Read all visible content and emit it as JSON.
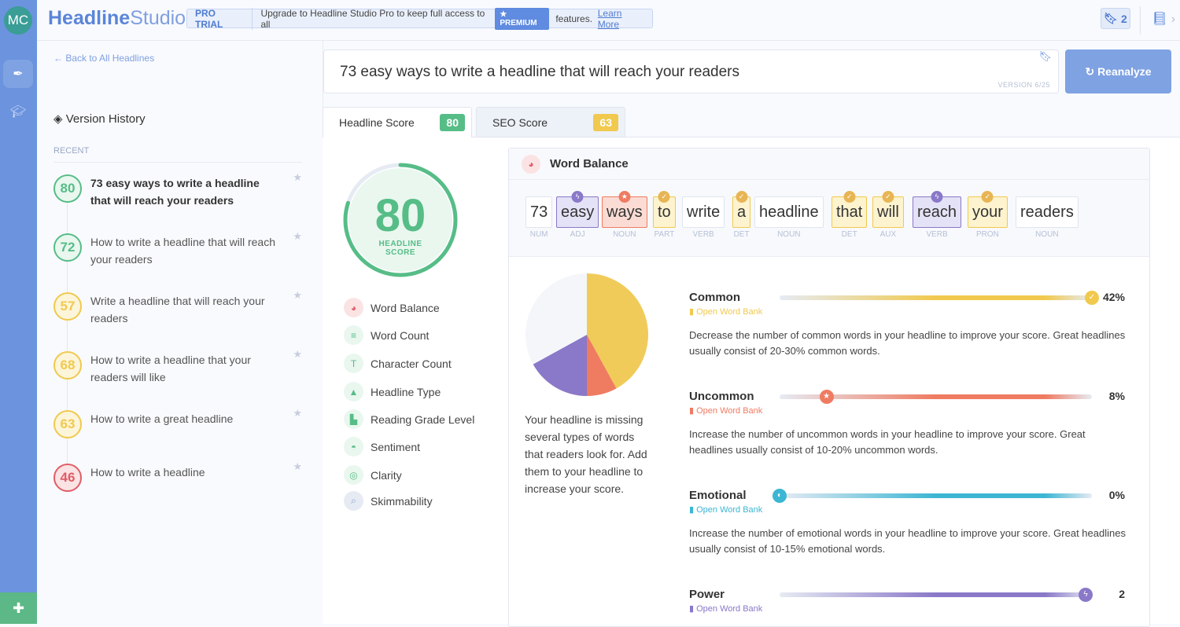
{
  "user": {
    "initials": "MC"
  },
  "app": {
    "name_bold": "Headline",
    "name_light": "Studio"
  },
  "promo": {
    "badge": "PRO TRIAL",
    "text": "Upgrade to Headline Studio Pro to keep full access to all",
    "premium": "PREMIUM",
    "after": "features.",
    "link": "Learn More"
  },
  "header": {
    "saved_count": "2"
  },
  "sidebar": {
    "back": "← Back to All Headlines",
    "version_history": "Version History",
    "recent": "RECENT",
    "items": [
      {
        "score": "80",
        "text": "73 easy ways to write a headline that will reach your readers",
        "color": "#56bd87",
        "bg": "#e9f7ef",
        "active": true
      },
      {
        "score": "72",
        "text": "How to write a headline that will reach your readers",
        "color": "#56bd87",
        "bg": "#e9f7ef"
      },
      {
        "score": "57",
        "text": "Write a headline that will reach your readers",
        "color": "#f0c94e",
        "bg": "#fdf5d9"
      },
      {
        "score": "68",
        "text": "How to write a headline that your readers will like",
        "color": "#f0c94e",
        "bg": "#fdf5d9"
      },
      {
        "score": "63",
        "text": "How to write a great headline",
        "color": "#f0c94e",
        "bg": "#fdf5d9"
      },
      {
        "score": "46",
        "text": "How to write a headline",
        "color": "#e05d66",
        "bg": "#fbe3e4"
      }
    ]
  },
  "editor": {
    "headline": "73 easy ways to write a headline that will reach your readers",
    "version": "VERSION 6/25",
    "reanalyze": "Reanalyze"
  },
  "tabs": [
    {
      "label": "Headline Score",
      "score": "80",
      "color": "#56bd87"
    },
    {
      "label": "SEO Score",
      "score": "63",
      "color": "#f0c94e"
    }
  ],
  "gauge": {
    "score": "80",
    "label1": "HEADLINE",
    "label2": "SCORE",
    "fraction": 0.8
  },
  "metrics": [
    "Word Balance",
    "Word Count",
    "Character Count",
    "Headline Type",
    "Reading Grade Level",
    "Sentiment",
    "Clarity",
    "Skimmability"
  ],
  "word_balance": {
    "title": "Word Balance",
    "words": [
      {
        "w": "73",
        "pos": "NUM",
        "type": "none"
      },
      {
        "w": "easy",
        "pos": "ADJ",
        "type": "power"
      },
      {
        "w": "ways",
        "pos": "NOUN",
        "type": "uncommon"
      },
      {
        "w": "to",
        "pos": "PART",
        "type": "common"
      },
      {
        "w": "write",
        "pos": "VERB",
        "type": "none"
      },
      {
        "w": "a",
        "pos": "DET",
        "type": "common"
      },
      {
        "w": "headline",
        "pos": "NOUN",
        "type": "none"
      },
      {
        "w": "that",
        "pos": "DET",
        "type": "common"
      },
      {
        "w": "will",
        "pos": "AUX",
        "type": "common"
      },
      {
        "w": "reach",
        "pos": "VERB",
        "type": "power"
      },
      {
        "w": "your",
        "pos": "PRON",
        "type": "common"
      },
      {
        "w": "readers",
        "pos": "NOUN",
        "type": "none"
      }
    ],
    "pie_text": "Your headline is missing several types of words that readers look for. Add them to your headline to increase your score.",
    "categories": [
      {
        "name": "Common",
        "value": "42%",
        "level": 1.0,
        "color": "#f0c94e",
        "bank": "Open Word Bank",
        "desc": "Decrease the number of common words in your headline to improve your score. Great headlines usually consist of 20-30% common words."
      },
      {
        "name": "Uncommon",
        "value": "8%",
        "level": 0.15,
        "color": "#ef7b61",
        "bank": "Open Word Bank",
        "desc": "Increase the number of uncommon words in your headline to improve your score. Great headlines usually consist of 10-20% uncommon words."
      },
      {
        "name": "Emotional",
        "value": "0%",
        "level": 0.0,
        "color": "#3cb6d3",
        "bank": "Open Word Bank",
        "desc": "Increase the number of emotional words in your headline to improve your score. Great headlines usually consist of 10-15% emotional words."
      },
      {
        "name": "Power",
        "value": "2",
        "level": 0.98,
        "color": "#8a78c8",
        "bank": "Open Word Bank",
        "desc": ""
      }
    ],
    "pie_shares": [
      {
        "k": "Common",
        "v": 42,
        "color": "#f0cb5a"
      },
      {
        "k": "Uncommon",
        "v": 8,
        "color": "#ef7b61"
      },
      {
        "k": "Power",
        "v": 17,
        "color": "#8a78c8"
      },
      {
        "k": "Other",
        "v": 33,
        "color": "#f4f6fa"
      }
    ]
  }
}
